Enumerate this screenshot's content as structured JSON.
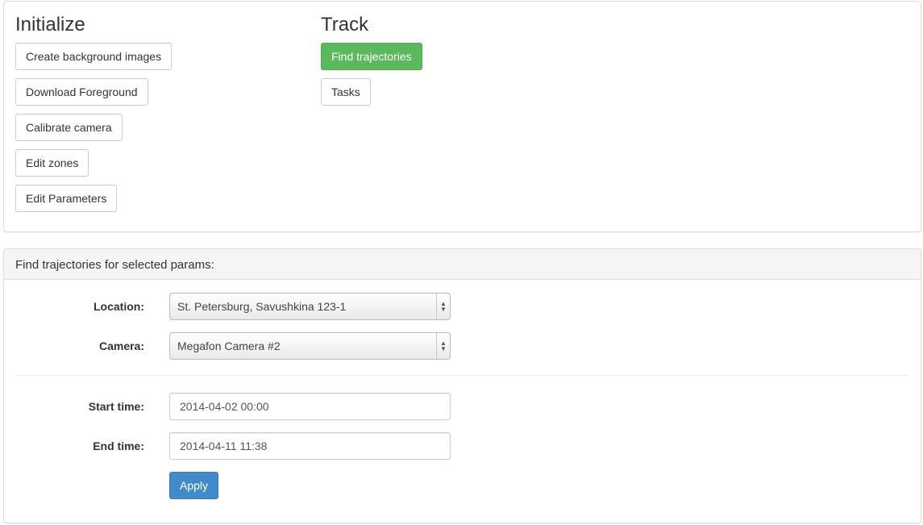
{
  "initialize": {
    "title": "Initialize",
    "buttons": [
      "Create background images",
      "Download Foreground",
      "Calibrate camera",
      "Edit zones",
      "Edit Parameters"
    ]
  },
  "track": {
    "title": "Track",
    "buttons": [
      "Find trajectories",
      "Tasks"
    ]
  },
  "form": {
    "heading": "Find trajectories for selected params:",
    "location_label": "Location:",
    "location_value": "St. Petersburg, Savushkina 123-1",
    "camera_label": "Camera:",
    "camera_value": "Megafon Camera #2",
    "start_label": "Start time:",
    "start_value": "2014-04-02 00:00",
    "end_label": "End time:",
    "end_value": "2014-04-11 11:38",
    "apply_label": "Apply"
  },
  "colors": {
    "success": "#5cb85c",
    "primary": "#428bca",
    "panel_heading_bg": "#f5f5f5",
    "border": "#dddddd"
  },
  "icons": {
    "select_arrows": "up-down-arrows-icon"
  }
}
